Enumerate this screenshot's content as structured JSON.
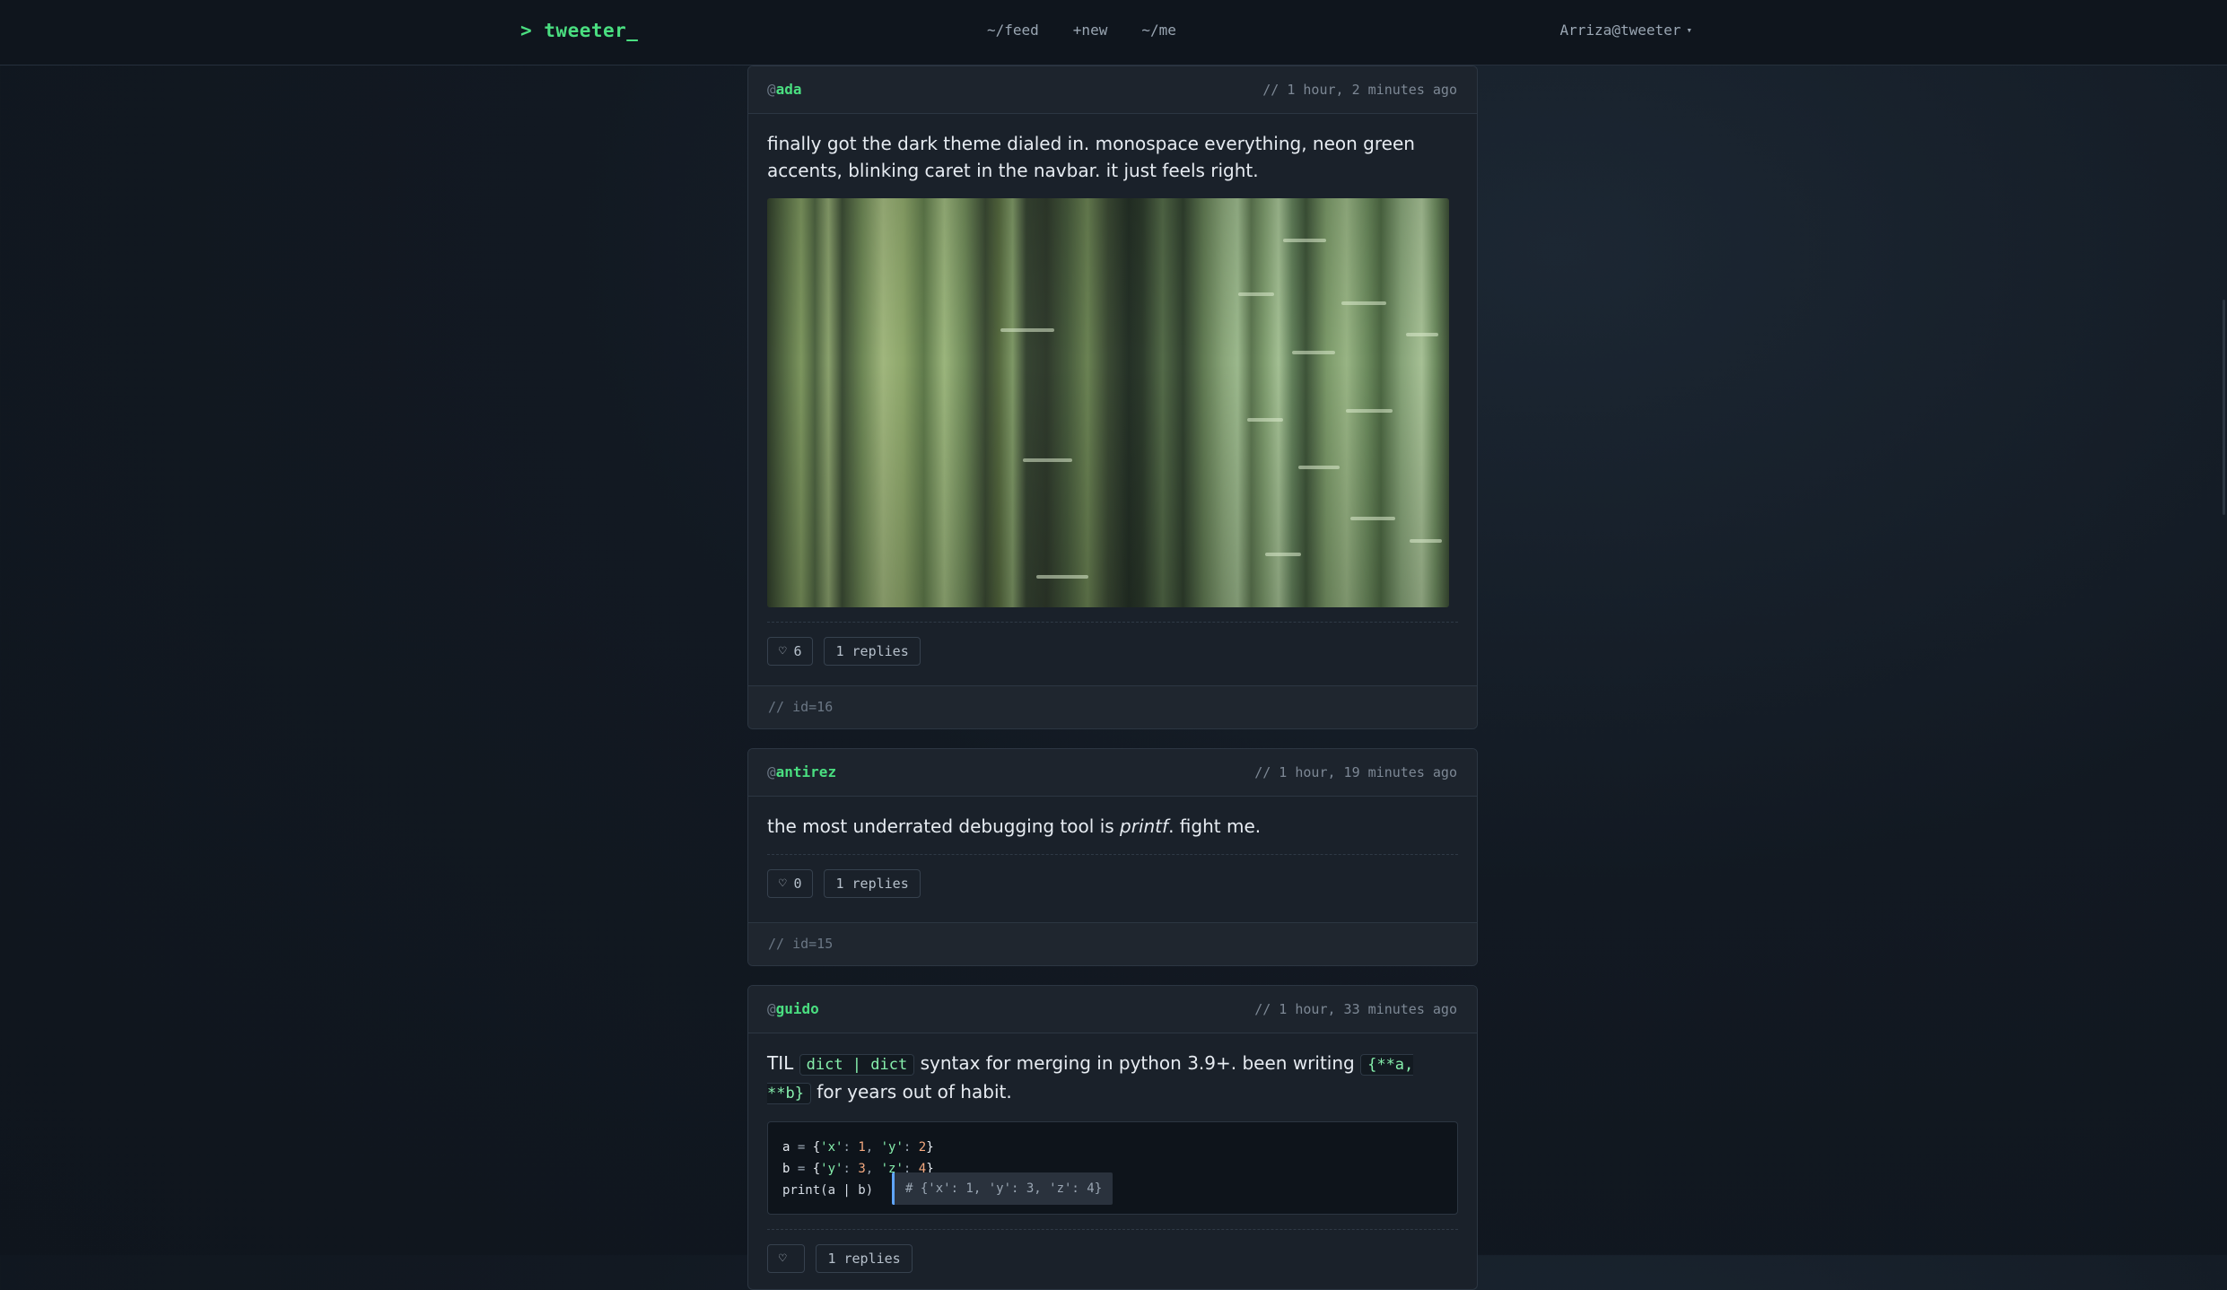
{
  "nav": {
    "brand": "> tweeter_",
    "links": [
      "~/feed",
      "+new",
      "~/me"
    ],
    "user": "Arriza@tweeter",
    "user_caret": "▾"
  },
  "posts": [
    {
      "at": "@",
      "handle": "ada",
      "time": "// 1 hour, 2 minutes ago",
      "text": "finally got the dark theme dialed in. monospace everything, neon green accents, blinking caret in the navbar. it just feels right.",
      "image_alt": "bamboo forest photo",
      "likes": "6",
      "replies": "1 replies",
      "footer": "// id=16"
    },
    {
      "at": "@",
      "handle": "antirez",
      "time": "// 1 hour, 19 minutes ago",
      "text_before": "the most underrated debugging tool is ",
      "text_em": "printf",
      "text_after": ". fight me.",
      "likes": "0",
      "replies": "1 replies",
      "footer": "// id=15"
    },
    {
      "at": "@",
      "handle": "guido",
      "time": "// 1 hour, 33 minutes ago",
      "text_p1": "TIL ",
      "code1": "dict | dict",
      "text_p2": " syntax for merging in python 3.9+. been writing ",
      "code2": "{**a, **b}",
      "text_p3": " for years out of habit.",
      "code_lines": [
        "a = {'x': 1, 'y': 2}",
        "b = {'y': 3, 'z': 4}",
        "print(a | b)"
      ],
      "code_comment": "# {'x': 1, 'y': 3, 'z': 4}",
      "likes": "",
      "replies": "1 replies"
    }
  ],
  "icons": {
    "like": "heart-icon",
    "dropdown": "chevron-down-icon"
  },
  "colors": {
    "accent": "#4ade80",
    "bg": "#121922",
    "card": "#1a212a"
  }
}
